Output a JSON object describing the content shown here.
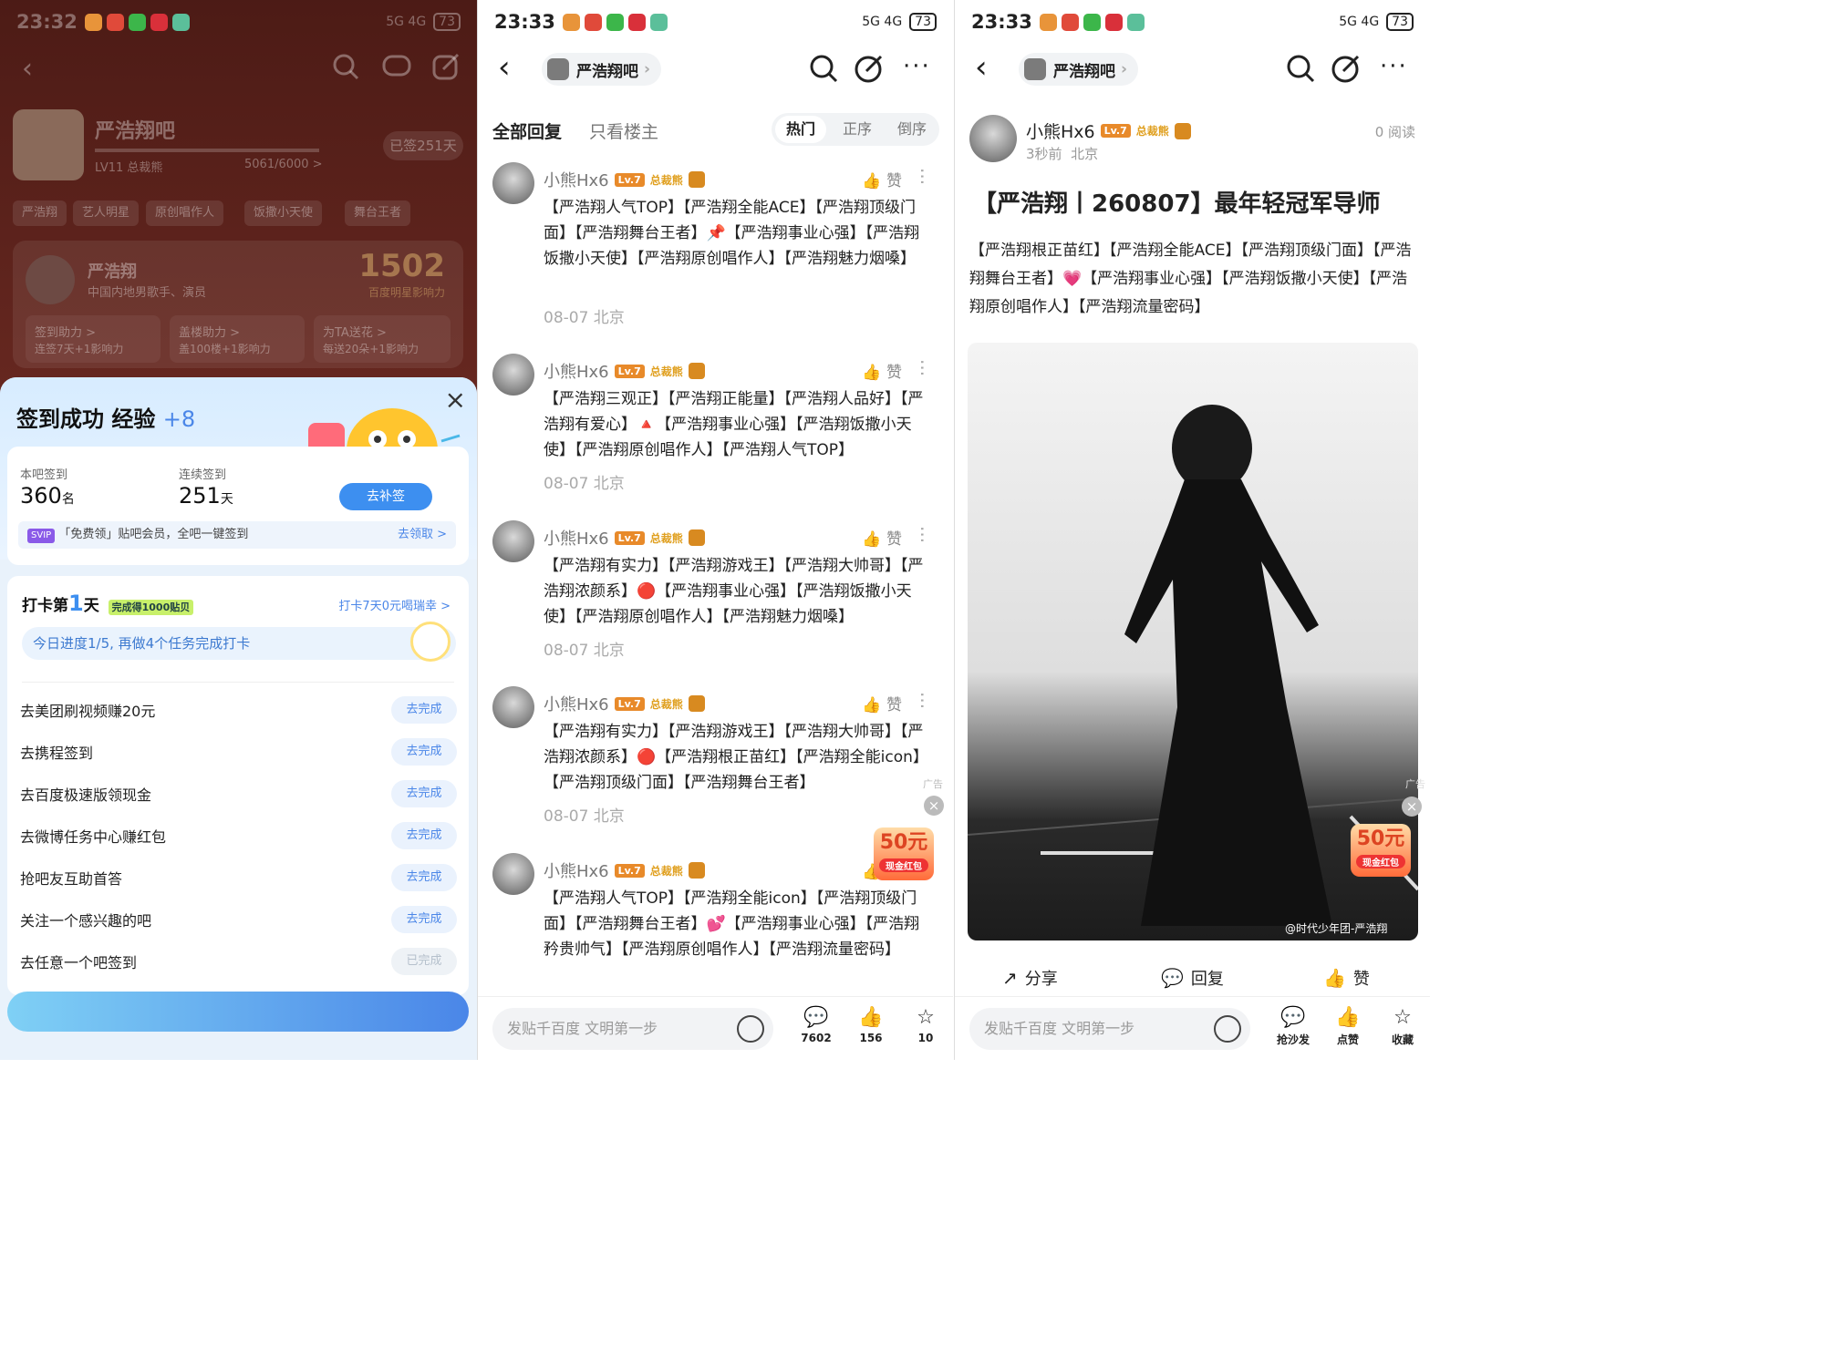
{
  "panel1": {
    "status_time": "23:32",
    "signal": "5G 4G",
    "battery": "73",
    "forum_name": "严浩翔吧",
    "forum_level": "LV11 总裁熊",
    "forum_exp": "5061/6000 >",
    "signed_days_badge": "已签251天",
    "chips": [
      "严浩翔",
      "艺人明星",
      "原创唱作人",
      "饭撒小天使",
      "舞台王者"
    ],
    "star_name": "严浩翔",
    "star_desc": "中国内地男歌手、演员",
    "star_score": "1502",
    "star_score_label": "百度明星影响力",
    "boosts": [
      {
        "title": "签到助力 >",
        "desc": "连签7天+1影响力"
      },
      {
        "title": "盖楼助力 >",
        "desc": "盖100楼+1影响力"
      },
      {
        "title": "为TA送花 >",
        "desc": "每送20朵+1影响力"
      }
    ],
    "sheet": {
      "title": "签到成功 经验",
      "exp_gain": "+8",
      "rank_label": "本吧签到",
      "rank_value": "360",
      "rank_unit": "名",
      "streak_label": "连续签到",
      "streak_value": "251",
      "streak_unit": "天",
      "makeup_button": "去补签",
      "vip_tag": "SVIP",
      "vip_text": "「免费领」贴吧会员，全吧一键签到",
      "vip_link": "去领取 >",
      "checkin_prefix": "打卡第",
      "checkin_day": "1",
      "checkin_suffix": "天",
      "checkin_reward": "完成得1000贴贝",
      "checkin_link": "打卡7天0元喝瑞幸 >",
      "progress_text": "今日进度1/5, 再做4个任务完成打卡",
      "tasks": [
        {
          "label": "去美团刷视频赚20元",
          "btn": "去完成",
          "done": false
        },
        {
          "label": "去携程签到",
          "btn": "去完成",
          "done": false
        },
        {
          "label": "去百度极速版领现金",
          "btn": "去完成",
          "done": false
        },
        {
          "label": "去微博任务中心赚红包",
          "btn": "去完成",
          "done": false
        },
        {
          "label": "抢吧友互助首答",
          "btn": "去完成",
          "done": false
        },
        {
          "label": "关注一个感兴趣的吧",
          "btn": "去完成",
          "done": false
        },
        {
          "label": "去任意一个吧签到",
          "btn": "已完成",
          "done": true
        }
      ]
    }
  },
  "panel2": {
    "status_time": "23:33",
    "forum_name": "严浩翔吧",
    "tabs": [
      "全部回复",
      "只看楼主"
    ],
    "sort": [
      "热门",
      "正序",
      "倒序"
    ],
    "replies": [
      {
        "user": "小熊Hx6",
        "level": "Lv.7",
        "badge": "总裁熊",
        "like": "赞",
        "text": "【严浩翔人气TOP】【严浩翔全能ACE】【严浩翔顶级门面】【严浩翔舞台王者】📌【严浩翔事业心强】【严浩翔饭撒小天使】【严浩翔原创唱作人】【严浩翔魅力烟嗓】",
        "meta": "08-07 北京"
      },
      {
        "user": "小熊Hx6",
        "level": "Lv.7",
        "badge": "总裁熊",
        "like": "赞",
        "text": "【严浩翔三观正】【严浩翔正能量】【严浩翔人品好】【严浩翔有爱心】🔺【严浩翔事业心强】【严浩翔饭撒小天使】【严浩翔原创唱作人】【严浩翔人气TOP】",
        "meta": "08-07 北京"
      },
      {
        "user": "小熊Hx6",
        "level": "Lv.7",
        "badge": "总裁熊",
        "like": "赞",
        "text": "【严浩翔有实力】【严浩翔游戏王】【严浩翔大帅哥】【严浩翔浓颜系】🔴【严浩翔事业心强】【严浩翔饭撒小天使】【严浩翔原创唱作人】【严浩翔魅力烟嗓】",
        "meta": "08-07 北京"
      },
      {
        "user": "小熊Hx6",
        "level": "Lv.7",
        "badge": "总裁熊",
        "like": "赞",
        "text": "【严浩翔有实力】【严浩翔游戏王】【严浩翔大帅哥】【严浩翔浓颜系】🔴【严浩翔根正苗红】【严浩翔全能icon】【严浩翔顶级门面】【严浩翔舞台王者】",
        "meta": "08-07 北京"
      },
      {
        "user": "小熊Hx6",
        "level": "Lv.7",
        "badge": "总裁熊",
        "like": "赞",
        "text": "【严浩翔人气TOP】【严浩翔全能icon】【严浩翔顶级门面】【严浩翔舞台王者】💕【严浩翔事业心强】【严浩翔矜贵帅气】【严浩翔原创唱作人】【严浩翔流量密码】",
        "meta": ""
      }
    ],
    "ad_tag": "广告",
    "ad_amount": "50元",
    "ad_label": "现金红包",
    "input_placeholder": "发贴千百度 文明第一步",
    "actions": [
      {
        "icon": "comment-icon",
        "label": "7602"
      },
      {
        "icon": "like-icon",
        "label": "156"
      },
      {
        "icon": "star-icon",
        "label": "10"
      }
    ]
  },
  "panel3": {
    "status_time": "23:33",
    "forum_name": "严浩翔吧",
    "author": "小熊Hx6",
    "level": "Lv.7",
    "badge": "总裁熊",
    "post_time": "3秒前",
    "post_loc": "北京",
    "reads": "0 阅读",
    "title": "【严浩翔丨260807】最年轻冠军导师",
    "body": "【严浩翔根正苗红】【严浩翔全能ACE】【严浩翔顶级门面】【严浩翔舞台王者】💗【严浩翔事业心强】【严浩翔饭撒小天使】【严浩翔原创唱作人】【严浩翔流量密码】",
    "watermark": "@时代少年团-严浩翔",
    "ad_tag": "广告",
    "ad_amount": "50元",
    "ad_label": "现金红包",
    "post_actions": [
      "分享",
      "回复",
      "赞"
    ],
    "input_placeholder": "发贴千百度 文明第一步",
    "actions": [
      {
        "icon": "sofa-icon",
        "label": "抢沙发"
      },
      {
        "icon": "like-icon",
        "label": "点赞"
      },
      {
        "icon": "star-icon",
        "label": "收藏"
      }
    ]
  }
}
